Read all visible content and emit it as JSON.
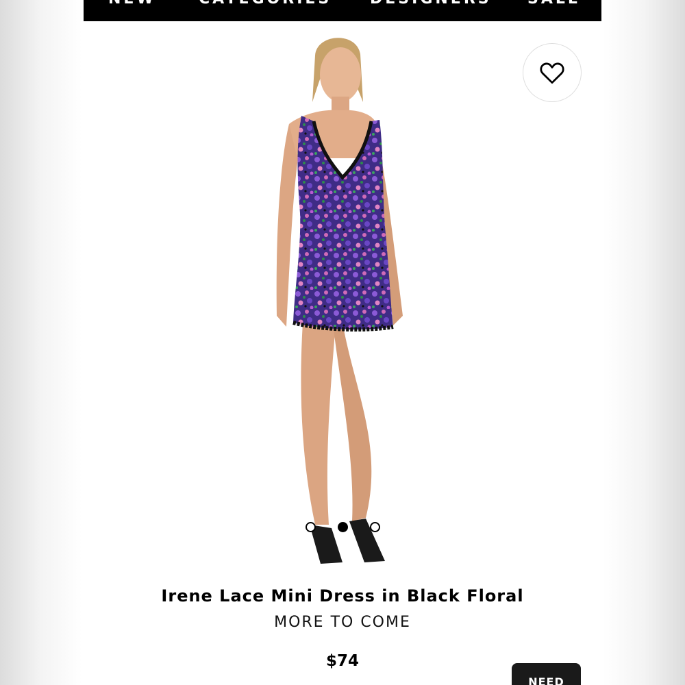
{
  "nav": {
    "items": [
      {
        "label": "NEW"
      },
      {
        "label": "CATEGORIES"
      },
      {
        "label": "DESIGNERS"
      },
      {
        "label": "SALE"
      }
    ]
  },
  "product": {
    "title": "Irene Lace Mini Dress in Black Floral",
    "brand": "MORE TO COME",
    "price": "$74",
    "image_description": "model-wearing-dress"
  },
  "carousel": {
    "total": 3,
    "active": 2
  },
  "wishlist": {
    "icon": "heart-icon"
  },
  "help": {
    "label": "NEED"
  },
  "colors": {
    "nav_background": "#000000",
    "dress_purple": "#5b3a9e",
    "help_button": "#1a1a1a"
  }
}
